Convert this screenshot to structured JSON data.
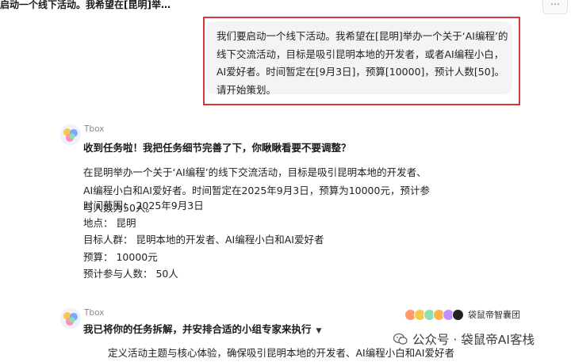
{
  "header": {
    "title": "启动一个线下活动。我希望在[昆明]举…",
    "more_icon": "more-icon"
  },
  "user_message": {
    "text": "我们要启动一个线下活动。我希望在[昆明]举办一个关于‘AI编程’的线下交流活动，目标是吸引昆明本地的开发者，或者AI编程小白，AI爱好者。时间暂定在[9月3日]，预算[10000]，预计人数[50]。请开始策划。",
    "highlight_color": "#d23b3b"
  },
  "bot_reply_1": {
    "name": "Tbox",
    "headline": "收到任务啦！我把任务细节完善了下，你瞅瞅看要不要调整？",
    "summary": "在昆明举办一个关于‘AI编程’的线下交流活动，目标是吸引昆明本地的开发者、AI编程小白和AI爱好者。时间暂定在2025年9月3日，预算为10000元，预计参与人数为50人。",
    "details": [
      "时间范围： 2025年9月3日",
      "地点： 昆明",
      "目标人群： 昆明本地的开发者、AI编程小白和AI爱好者",
      "预算： 10000元",
      "预计参与人数： 50人"
    ]
  },
  "bot_reply_2": {
    "name": "Tbox",
    "team_label": "袋鼠帝智囊团",
    "headline": "我已将你的任务拆解，并安排合适的小组专家来执行",
    "expand_icon": "caret-down-icon",
    "first_task": "定义活动主题与核心体验，确保吸引昆明本地的开发者、AI编程小白和AI爱好者"
  },
  "watermark": {
    "text": "公众号 · 袋鼠帝AI客栈"
  }
}
